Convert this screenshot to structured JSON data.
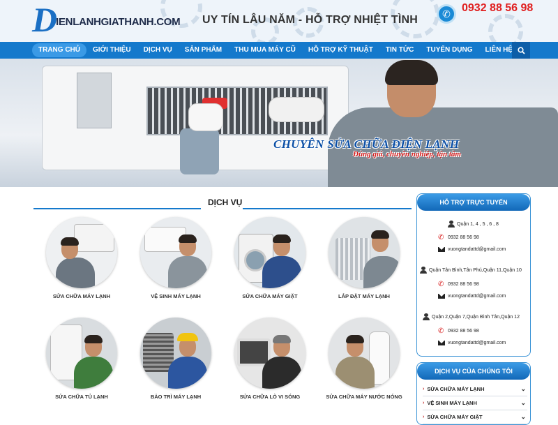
{
  "header": {
    "logo_d": "D",
    "logo_text": "ienlanhgiathanh.com",
    "slogan": "UY TÍN LÂU NĂM - HỖ TRỢ NHIỆT TÌNH",
    "hotline": "0932 88 56 98"
  },
  "nav": {
    "items": [
      "TRANG CHỦ",
      "GIỚI THIỆU",
      "DỊCH VỤ",
      "SẢN PHẨM",
      "THU MUA MÁY CŨ",
      "HỖ TRỢ KỸ THUẬT",
      "TIN TỨC",
      "TUYỂN DỤNG",
      "LIÊN HỆ"
    ],
    "active": "TRANG CHỦ"
  },
  "banner": {
    "title": "CHUYÊN SỬA CHỮA ĐIỆN LẠNH",
    "subtitle": "Đúng giá, chuyên nghiệp, tận tâm"
  },
  "services": {
    "title": "DỊCH VỤ",
    "items": [
      {
        "label": "SỬA CHỮA MÁY LẠNH"
      },
      {
        "label": "VỆ SINH MÁY LẠNH"
      },
      {
        "label": "SỬA CHỮA MÁY GIẶT"
      },
      {
        "label": "LẮP ĐẶT MÁY LẠNH"
      },
      {
        "label": "SỬA CHỮA TỦ LẠNH"
      },
      {
        "label": "BẢO TRÌ MÁY LẠNH"
      },
      {
        "label": "SỬA CHỮA LÒ VI SÓNG"
      },
      {
        "label": "SỬA CHỮA MÁY NƯỚC NÓNG"
      }
    ]
  },
  "support": {
    "title": "HỖ TRỢ TRỰC TUYẾN",
    "groups": [
      {
        "area": "Quận 1, 4 , 5 , 6 , 8",
        "phone": "0932 88 56 98",
        "email": "vuongtandattd@gmail.com"
      },
      {
        "area": "Quận Tân Bình,Tân Phú,Quận 11,Quận 10",
        "phone": "0932 88 56 98",
        "email": "vuongtandattd@gmail.com"
      },
      {
        "area": "Quận 2,Quận 7,Quận Bình Tân,Quận 12",
        "phone": "0932 88 56 98",
        "email": "vuongtandattd@gmail.com"
      }
    ]
  },
  "our_services": {
    "title": "DỊCH VỤ CỦA CHÚNG TÔI",
    "items": [
      "SỬA CHỮA MÁY LẠNH",
      "VỆ SINH MÁY LẠNH",
      "SỬA CHỮA MÁY GIẶT"
    ]
  },
  "colors": {
    "primary": "#1479cc",
    "accent": "#d61c1c",
    "banner_title": "#0b4fa6"
  }
}
